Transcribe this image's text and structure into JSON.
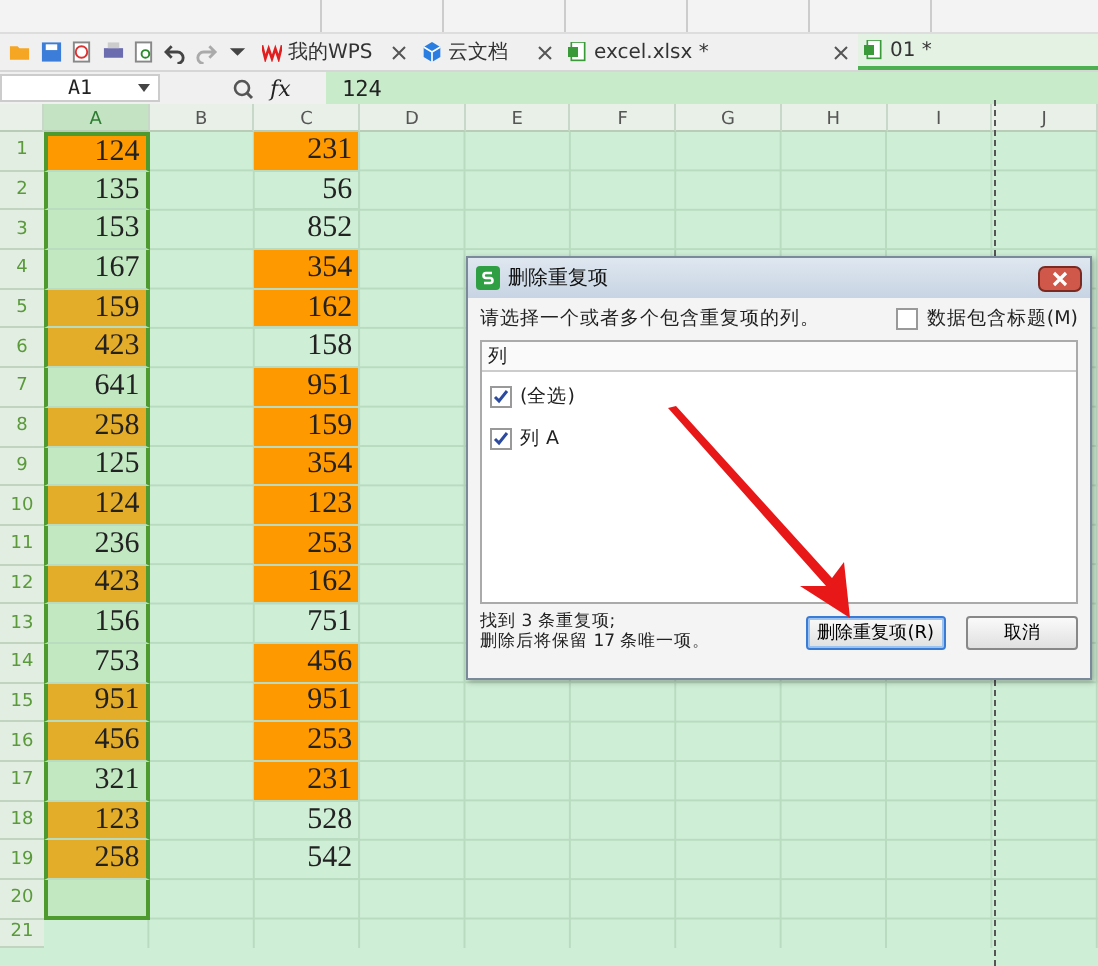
{
  "tabs": [
    {
      "label": "我的WPS",
      "kind": "wps",
      "selected": false
    },
    {
      "label": "云文档",
      "kind": "cloud",
      "selected": false
    },
    {
      "label": "excel.xlsx *",
      "kind": "sheet",
      "selected": false
    },
    {
      "label": "01 *",
      "kind": "sheet",
      "selected": true
    }
  ],
  "formula_bar": {
    "cell_name": "A1",
    "fx": "fx",
    "value": "124"
  },
  "columns": [
    {
      "label": "A",
      "selected": true
    },
    {
      "label": "B",
      "selected": false
    },
    {
      "label": "C",
      "selected": false
    },
    {
      "label": "D",
      "selected": false
    },
    {
      "label": "E",
      "selected": false
    },
    {
      "label": "F",
      "selected": false
    },
    {
      "label": "G",
      "selected": false
    },
    {
      "label": "H",
      "selected": false
    },
    {
      "label": "I",
      "selected": false
    },
    {
      "label": "J",
      "selected": false
    }
  ],
  "rows": [
    {
      "number": "1",
      "a": {
        "value": "124",
        "color": "#ff9900",
        "selected": true
      },
      "c": {
        "value": "231",
        "color": "#ff9900"
      }
    },
    {
      "number": "2",
      "a": {
        "value": "135",
        "selected": true
      },
      "c": {
        "value": "56"
      }
    },
    {
      "number": "3",
      "a": {
        "value": "153",
        "selected": true
      },
      "c": {
        "value": "852"
      }
    },
    {
      "number": "4",
      "a": {
        "value": "167",
        "selected": true
      },
      "c": {
        "value": "354",
        "color": "#ff9900"
      }
    },
    {
      "number": "5",
      "a": {
        "value": "159",
        "color": "#e3ad2a",
        "selected": true
      },
      "c": {
        "value": "162",
        "color": "#ff9900"
      }
    },
    {
      "number": "6",
      "a": {
        "value": "423",
        "color": "#e3ad2a",
        "selected": true
      },
      "c": {
        "value": "158"
      }
    },
    {
      "number": "7",
      "a": {
        "value": "641",
        "selected": true
      },
      "c": {
        "value": "951",
        "color": "#ff9900"
      }
    },
    {
      "number": "8",
      "a": {
        "value": "258",
        "color": "#e3ad2a",
        "selected": true
      },
      "c": {
        "value": "159",
        "color": "#ff9900"
      }
    },
    {
      "number": "9",
      "a": {
        "value": "125",
        "selected": true
      },
      "c": {
        "value": "354",
        "color": "#ff9900"
      }
    },
    {
      "number": "10",
      "a": {
        "value": "124",
        "color": "#e3ad2a",
        "selected": true
      },
      "c": {
        "value": "123",
        "color": "#ff9900"
      }
    },
    {
      "number": "11",
      "a": {
        "value": "236",
        "selected": true
      },
      "c": {
        "value": "253",
        "color": "#ff9900"
      }
    },
    {
      "number": "12",
      "a": {
        "value": "423",
        "color": "#e3ad2a",
        "selected": true
      },
      "c": {
        "value": "162",
        "color": "#ff9900"
      }
    },
    {
      "number": "13",
      "a": {
        "value": "156",
        "selected": true
      },
      "c": {
        "value": "751"
      }
    },
    {
      "number": "14",
      "a": {
        "value": "753",
        "selected": true
      },
      "c": {
        "value": "456",
        "color": "#ff9900"
      }
    },
    {
      "number": "15",
      "a": {
        "value": "951",
        "color": "#e3ad2a",
        "selected": true
      },
      "c": {
        "value": "951",
        "color": "#ff9900"
      }
    },
    {
      "number": "16",
      "a": {
        "value": "456",
        "color": "#e3ad2a",
        "selected": true
      },
      "c": {
        "value": "253",
        "color": "#ff9900"
      }
    },
    {
      "number": "17",
      "a": {
        "value": "321",
        "selected": true
      },
      "c": {
        "value": "231",
        "color": "#ff9900"
      }
    },
    {
      "number": "18",
      "a": {
        "value": "123",
        "color": "#e3ad2a",
        "selected": true
      },
      "c": {
        "value": "528"
      }
    },
    {
      "number": "19",
      "a": {
        "value": "258",
        "color": "#e3ad2a",
        "selected": true
      },
      "c": {
        "value": "542"
      }
    },
    {
      "number": "20",
      "a": {
        "selected": true
      }
    },
    {
      "number": "21"
    }
  ],
  "dialog": {
    "title": "删除重复项",
    "prompt": "请选择一个或者多个包含重复项的列。",
    "header_option": {
      "label": "数据包含标题(M)",
      "checked": false
    },
    "list_header": "列",
    "items": [
      {
        "label": "(全选)",
        "checked": true
      },
      {
        "label": "列 A",
        "checked": true
      }
    ],
    "status": [
      "找到 3 条重复项;",
      "删除后将保留 17 条唯一项。"
    ],
    "buttons": [
      {
        "label": "删除重复项(R)",
        "default": true
      },
      {
        "label": "取消",
        "default": false
      }
    ]
  }
}
